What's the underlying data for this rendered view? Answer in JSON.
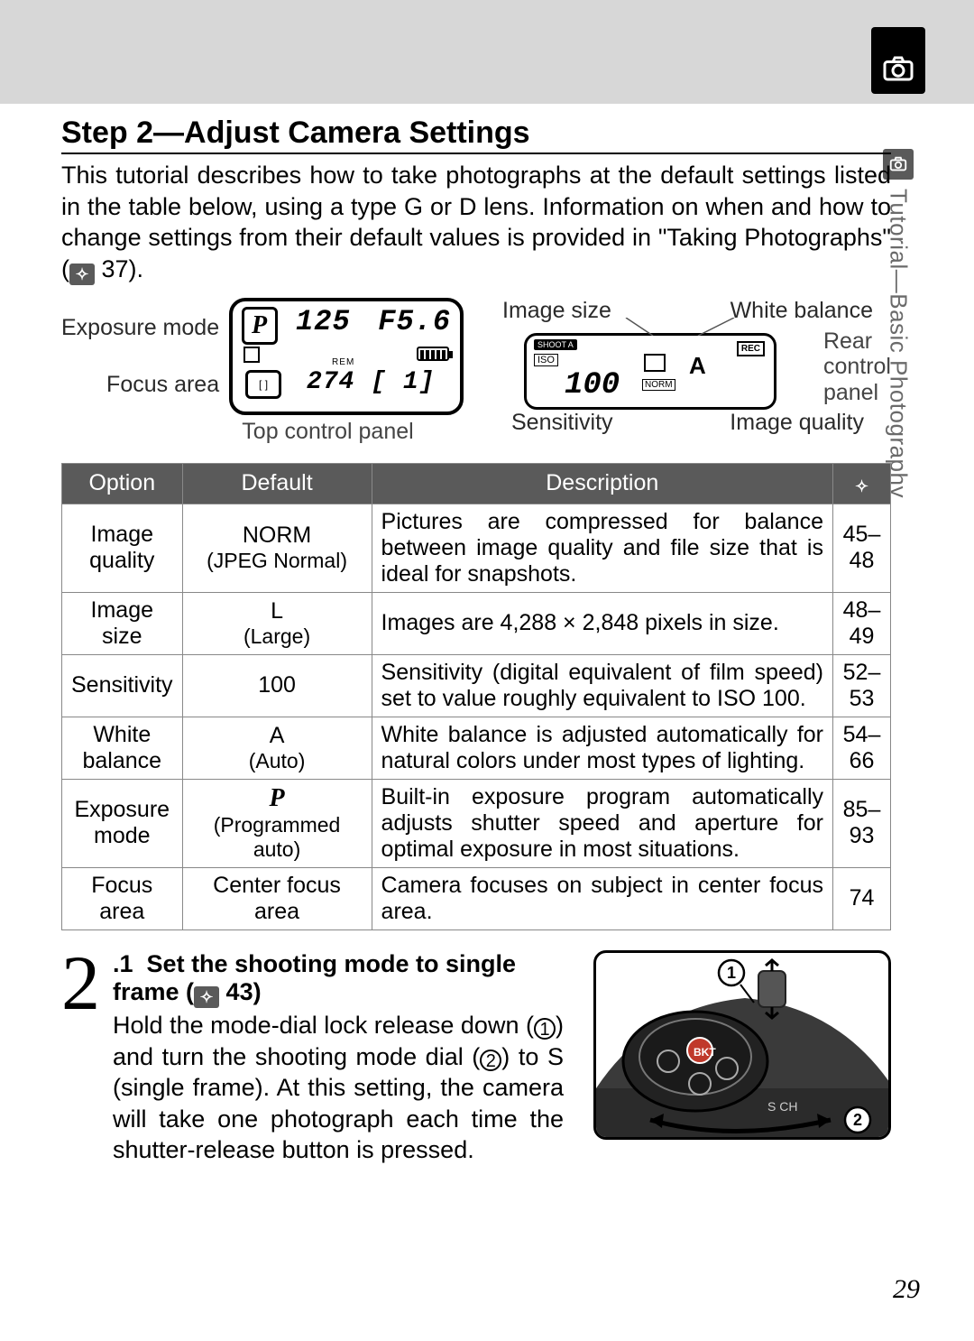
{
  "side_tab_label": "Tutorial—Basic Photography",
  "step_title": "Step 2—Adjust Camera Settings",
  "intro_text": "This tutorial describes how to take photographs at the default settings listed in the table below, using a type G or D lens. Information on when and how to change settings from their default values is provided in \"Taking Photographs\" (",
  "intro_ref": "37).",
  "diagram": {
    "exposure_mode": "Exposure mode",
    "focus_area": "Focus area",
    "top_panel": "Top control panel",
    "image_size": "Image size",
    "white_balance": "White balance",
    "sensitivity": "Sensitivity",
    "image_quality": "Image quality",
    "rear_panel1": "Rear",
    "rear_panel2": "control",
    "rear_panel3": "panel",
    "lcd_p": "P",
    "lcd_shutter": "125",
    "lcd_f": "F5.6",
    "lcd_rem": "REM",
    "lcd_count": "274 [   1]",
    "rear_shoot": "SHOOT A",
    "rear_iso": "ISO",
    "rear_100": "100",
    "rear_norm": "NORM",
    "rear_a": "A",
    "rear_rec": "REC"
  },
  "table": {
    "headers": {
      "option": "Option",
      "default": "Default",
      "description": "Description",
      "page_icon": "✧"
    },
    "rows": [
      {
        "option": "Image quality",
        "default_main": "NORM",
        "default_sub": "(JPEG Normal)",
        "description": "Pictures are compressed for balance between image quality and file size that is ideal for snapshots.",
        "pages": "45–48"
      },
      {
        "option": "Image size",
        "default_main": "L",
        "default_sub": "(Large)",
        "description": "Images are 4,288 × 2,848 pixels in size.",
        "pages": "48–49"
      },
      {
        "option": "Sensitivity",
        "default_main": "100",
        "default_sub": "",
        "description": "Sensitivity (digital equivalent of film speed) set to value roughly equivalent to ISO 100.",
        "pages": "52–53"
      },
      {
        "option": "White balance",
        "default_main": "A",
        "default_sub": "(Auto)",
        "description": "White balance is adjusted automatically for natural colors under most types of lighting.",
        "pages": "54–66"
      },
      {
        "option": "Exposure mode",
        "default_main": "P",
        "default_sub": "(Programmed auto)",
        "description": "Built-in exposure program automatically adjusts shutter speed and aperture for optimal exposure in most situations.",
        "pages": "85–93"
      },
      {
        "option": "Focus area",
        "default_main": "Center focus area",
        "default_sub": "",
        "description": "Camera focuses on subject in center focus area.",
        "pages": "74"
      }
    ]
  },
  "substep": {
    "num": "2",
    "idx": ".1",
    "title": "Set the shooting mode to single frame (",
    "title_ref": "43)",
    "body_a": "Hold the mode-dial lock release down (",
    "body_b": ") and turn the shooting mode dial (",
    "body_c": ") to S (single frame). At this setting, the camera will take one photograph each time the shutter-release button is pressed."
  },
  "page_number": "29"
}
